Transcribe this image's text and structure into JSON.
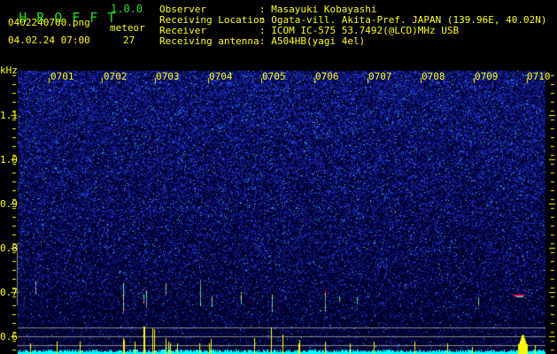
{
  "app": {
    "name_letters": [
      "H",
      "R",
      "O",
      "F",
      "F",
      "T"
    ],
    "version": "1.0.0"
  },
  "file": {
    "name": "0402240700.png",
    "datetime": "04.02.24 07:00"
  },
  "meteor": {
    "label": "meteor",
    "count": "27"
  },
  "info": [
    {
      "label": "Observer",
      "value": ": Masayuki Kobayashi"
    },
    {
      "label": "Receiving Location",
      "value": ": Ogata-vill. Akita-Pref. JAPAN (139.96E, 40.02N)"
    },
    {
      "label": "Receiver",
      "value": ": ICOM IC-575 53.7492(@LCD)MHz USB"
    },
    {
      "label": "Receiving antenna",
      "value": ": A504HB(yagi 4el)"
    }
  ],
  "axis": {
    "y_unit": "kHz",
    "y_ticks": [
      "1.1",
      "1.0",
      "0.9",
      "0.8",
      "0.7",
      "0.6"
    ],
    "x_ticks": [
      "0701",
      "0702",
      "0703",
      "0704",
      "0705",
      "0706",
      "0707",
      "0708",
      "0709",
      "0710"
    ]
  },
  "colors": {
    "text": "#ffff00",
    "title": "#22dd22",
    "noise": "#2030ff",
    "baseline": "#00ffff",
    "spike": "#ffff00"
  }
}
